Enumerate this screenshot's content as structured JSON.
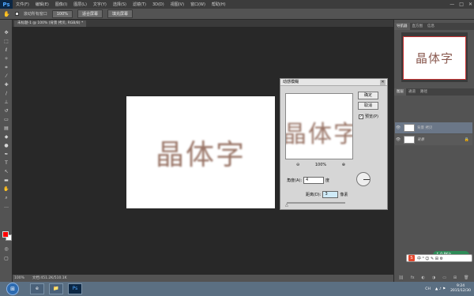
{
  "app": {
    "logo": "Ps"
  },
  "menubar": {
    "items": [
      "文件(F)",
      "编辑(E)",
      "图像(I)",
      "图层(L)",
      "文字(Y)",
      "选择(S)",
      "滤镜(T)",
      "3D(D)",
      "视图(V)",
      "窗口(W)",
      "帮助(H)"
    ]
  },
  "window_controls": {
    "minimize": "—",
    "maximize": "□",
    "close": "✕"
  },
  "options": {
    "scroll_all_label": "滚动所有窗口",
    "zoom_value": "100%",
    "fit_screen": "适合屏幕",
    "fill_screen": "填充屏幕"
  },
  "document": {
    "tab_title": "未标题-1 @ 100% (背景 拷贝, RGB/8) *",
    "canvas_text": "晶体字"
  },
  "dialog": {
    "title": "动感模糊",
    "ok": "确定",
    "cancel": "取消",
    "preview_label": "预览(P)",
    "preview_checked": "✓",
    "zoom_out": "⊖",
    "zoom_value": "100%",
    "zoom_in": "⊕",
    "angle_label": "角度(A):",
    "angle_value": "4",
    "angle_unit": "度",
    "distance_label": "距离(D):",
    "distance_value": "3",
    "distance_unit": "像素"
  },
  "navigator": {
    "tabs": [
      "导航器",
      "直方图",
      "信息"
    ],
    "thumb_text": "晶体字"
  },
  "layers": {
    "tabs": [
      "图层",
      "通道",
      "路径"
    ],
    "items": [
      {
        "name": "背景 拷贝",
        "eye": "👁"
      },
      {
        "name": "背景",
        "eye": "👁",
        "lock": "🔒"
      }
    ]
  },
  "status": {
    "zoom": "100%",
    "doc_info": "文档:451.2K/510.1K"
  },
  "taskbar": {
    "start": "⊞",
    "tasks": [
      "e",
      "📁",
      "Ps"
    ]
  },
  "tray": {
    "lang": "CH",
    "time": "9:24",
    "date": "2015/12/30",
    "ime_label": "S",
    "net_text": "↑ 0.8K/s"
  },
  "colors": {
    "foreground": "#ff0000",
    "background": "#ffffff",
    "accent": "#cc3333"
  }
}
